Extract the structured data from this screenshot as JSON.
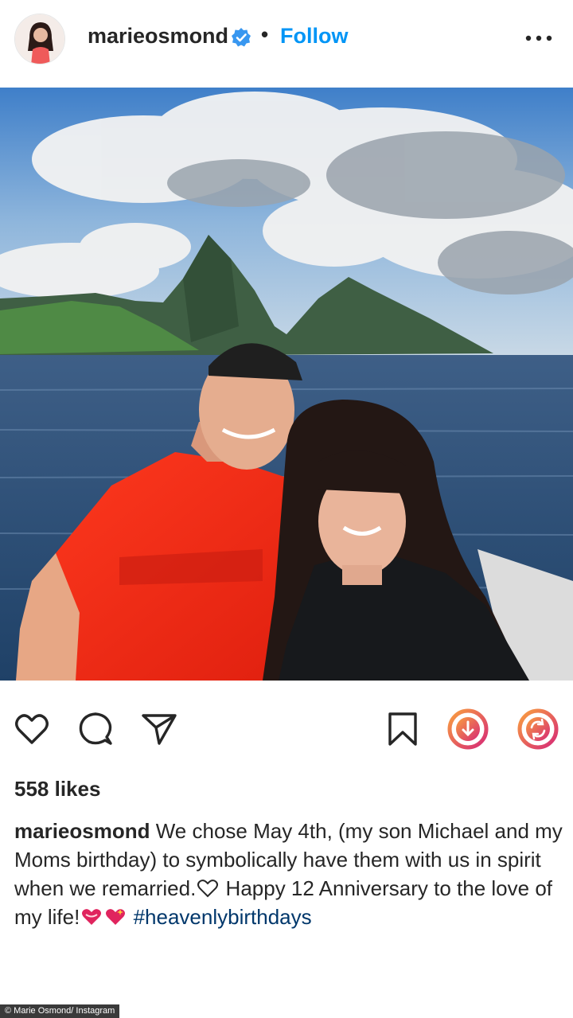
{
  "post_header": {
    "username": "marieosmond",
    "separator": "•",
    "follow_label": "Follow",
    "avatar_icon": "profile-avatar",
    "verified_icon": "verified-badge-icon",
    "more_icon": "more-options-icon"
  },
  "actions": {
    "like_icon": "heart-icon",
    "comment_icon": "comment-icon",
    "share_icon": "share-icon",
    "save_icon": "bookmark-icon",
    "download_icon": "download-icon",
    "repost_icon": "repost-icon"
  },
  "likes": "558 likes",
  "caption": {
    "username": "marieosmond",
    "text_part1": "We chose May 4th, (my son Michael and my Moms birthday) to symbolically have them with us in spirit when we remarried.",
    "text_part2": "Happy 12 Anniversary to the love of my life!",
    "hashtag": "#heavenlybirthdays"
  },
  "credit": "© Marie Osmond/ Instagram",
  "colors": {
    "link_blue": "#0095f6",
    "hashtag": "#00376b",
    "heart_red": "#e0245e",
    "gradient_start": "#f9a03f",
    "gradient_end": "#d62976"
  }
}
